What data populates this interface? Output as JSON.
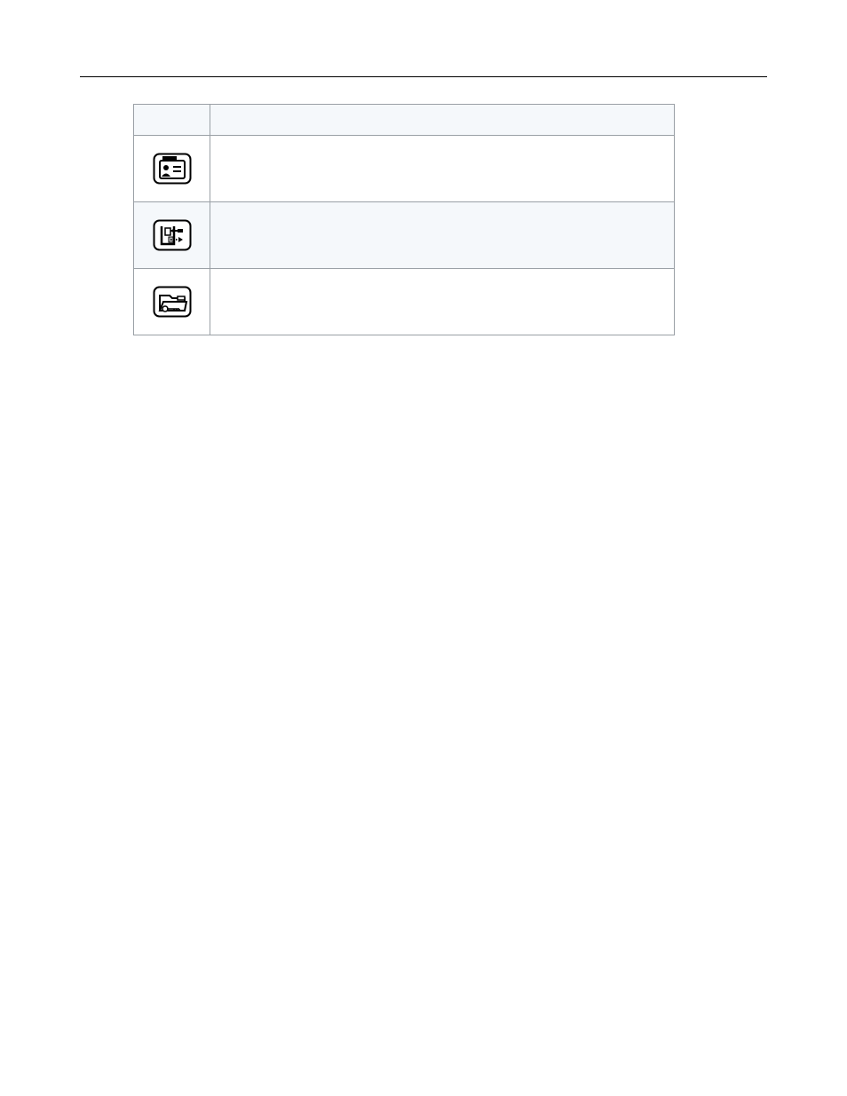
{
  "table": {
    "headers": {
      "icon": "",
      "description": ""
    },
    "rows": [
      {
        "iconName": "id-card-icon",
        "description": ""
      },
      {
        "iconName": "door-transfer-icon",
        "description": ""
      },
      {
        "iconName": "folder-key-icon",
        "description": ""
      }
    ]
  }
}
